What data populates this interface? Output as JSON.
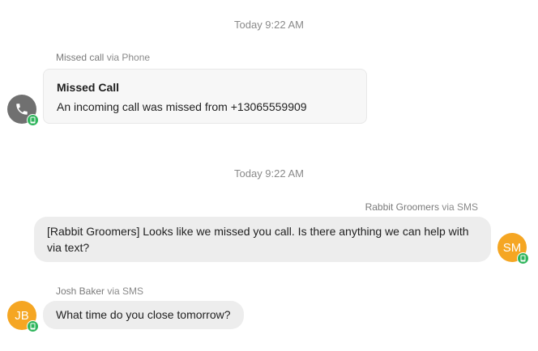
{
  "section1": {
    "timestamp": "Today 9:22 AM"
  },
  "missed_call": {
    "author": "Missed call",
    "channel": "via Phone",
    "title": "Missed Call",
    "body": "An incoming call was missed from +13065559909",
    "avatar_icon": "phone-icon",
    "badge_icon": "mobile-icon"
  },
  "section2": {
    "timestamp": "Today 9:22 AM"
  },
  "outgoing": {
    "author": "Rabbit Groomers",
    "channel": "via SMS",
    "text": "[Rabbit Groomers] Looks like we missed you call. Is there anything we can help with via text?",
    "avatar_initials": "SM",
    "badge_icon": "mobile-icon"
  },
  "incoming": {
    "author": "Josh Baker",
    "channel": "via SMS",
    "text": "What time do you close tomorrow?",
    "avatar_initials": "JB",
    "badge_icon": "mobile-icon"
  },
  "colors": {
    "accent_green": "#2fb55c",
    "avatar_orange": "#f5a623",
    "avatar_gray": "#707070",
    "bubble_bg": "#ededed"
  }
}
